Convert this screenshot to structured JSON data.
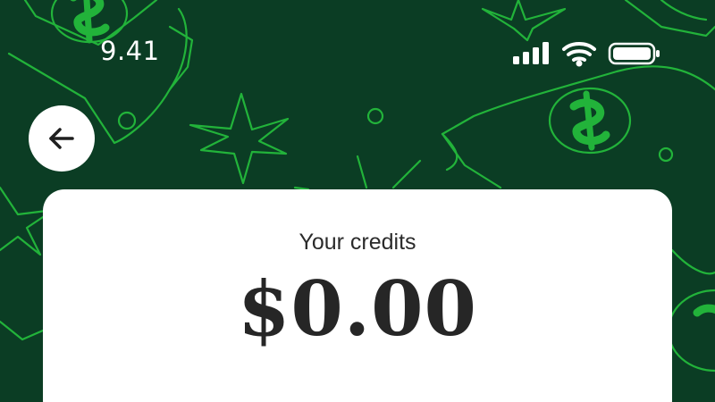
{
  "status_bar": {
    "time": "9.41",
    "signal_icon": "cellular-signal-icon",
    "wifi_icon": "wifi-icon",
    "battery_icon": "battery-icon"
  },
  "header": {
    "back_icon": "arrow-left-icon"
  },
  "credits_card": {
    "label": "Your credits",
    "amount": "$0.00"
  },
  "colors": {
    "background": "#0b3d24",
    "accent_line": "#22b33a",
    "card": "#ffffff",
    "text_dark": "#262626"
  }
}
